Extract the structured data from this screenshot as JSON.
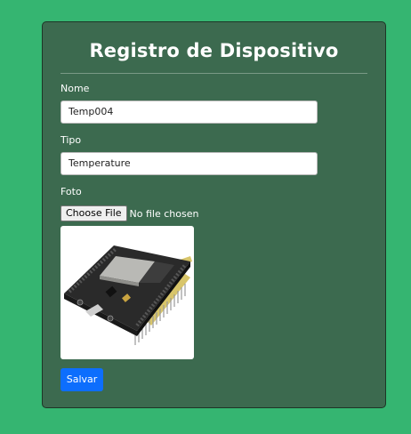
{
  "form": {
    "title": "Registro de Dispositivo",
    "nome_label": "Nome",
    "nome_value": "Temp004",
    "tipo_label": "Tipo",
    "tipo_value": "Temperature",
    "foto_label": "Foto",
    "file_button_label": "Choose File",
    "file_status": "No file chosen",
    "preview_icon": "esp32-board-image",
    "submit_label": "Salvar"
  },
  "colors": {
    "page_background": "#35b571",
    "card_background": "#3c6a4f",
    "primary_button": "#0d6efd"
  }
}
